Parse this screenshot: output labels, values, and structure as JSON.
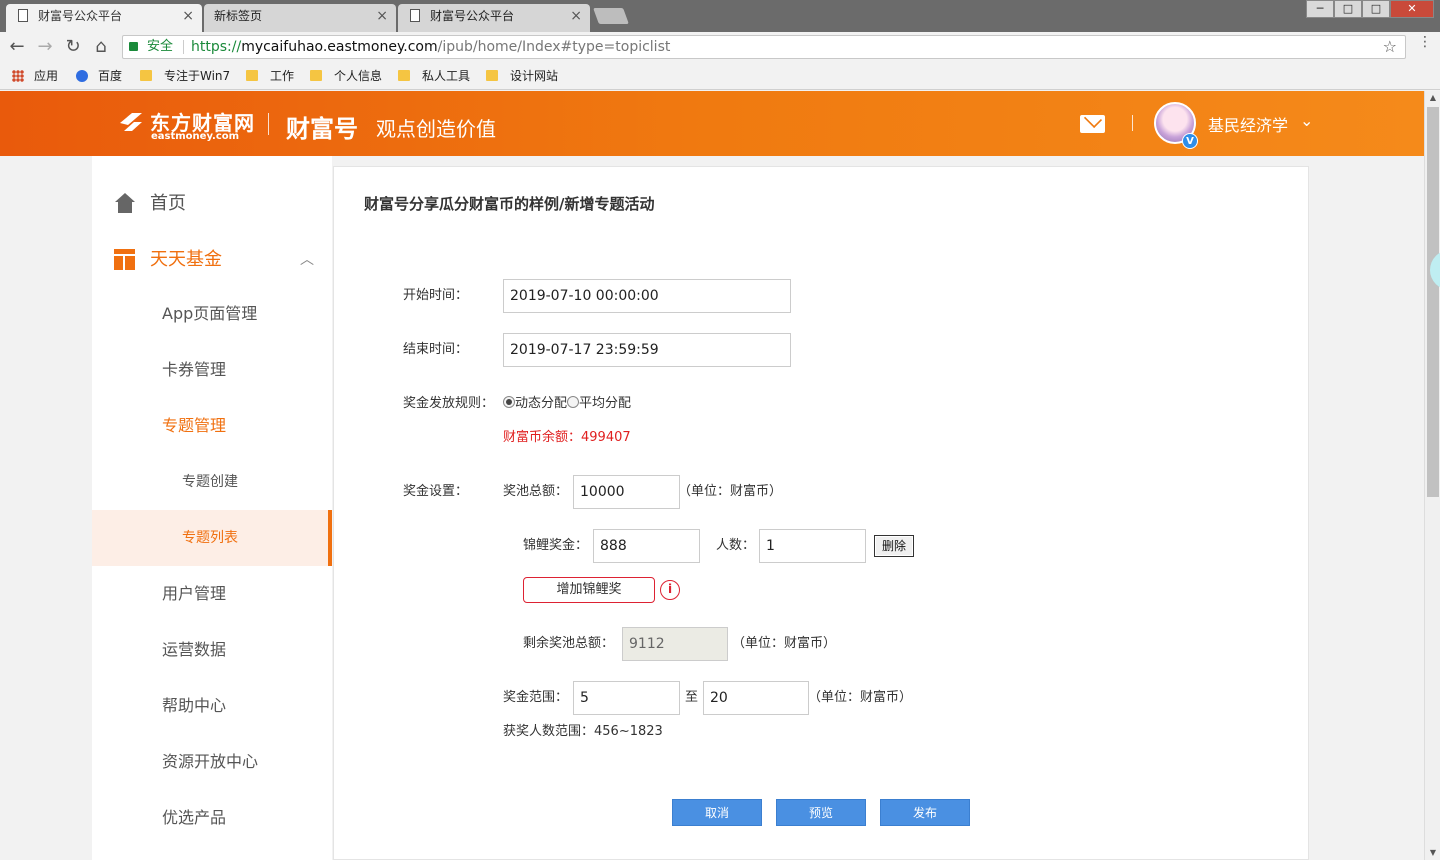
{
  "browser": {
    "tabs": [
      {
        "title": "财富号公众平台",
        "active": true
      },
      {
        "title": "新标签页",
        "active": false
      },
      {
        "title": "财富号公众平台",
        "active": false
      }
    ],
    "window_controls": {
      "minimize": "─",
      "maximize": "□",
      "close": "✕"
    },
    "secure_label": "安全",
    "url_scheme": "https://",
    "url_host": "mycaifuhao.eastmoney.com",
    "url_path": "/ipub/home/Index#type=topiclist",
    "bookmarks": [
      "应用",
      "百度",
      "专注于Win7",
      "工作",
      "个人信息",
      "私人工具",
      "设计网站"
    ]
  },
  "header": {
    "logo_cn": "东方财富网",
    "logo_en": "eastmoney.com",
    "brand": "财富号",
    "slogan": "观点创造价值",
    "user_name": "基民经济学",
    "badge": "V",
    "accent_color": "#f07010"
  },
  "sidebar": {
    "home": "首页",
    "fund": "天天基金",
    "items": [
      {
        "label": "App页面管理"
      },
      {
        "label": "卡券管理"
      },
      {
        "label": "专题管理"
      },
      {
        "label": "专题创建"
      },
      {
        "label": "专题列表"
      },
      {
        "label": "用户管理"
      },
      {
        "label": "运营数据"
      },
      {
        "label": "帮助中心"
      },
      {
        "label": "资源开放中心"
      },
      {
        "label": "优选产品"
      }
    ]
  },
  "form": {
    "title": "财富号分享瓜分财富币的样例/新增专题活动",
    "start_label": "开始时间：",
    "start_value": "2019-07-10 00:00:00",
    "end_label": "结束时间：",
    "end_value": "2019-07-17 23:59:59",
    "rule_label": "奖金发放规则：",
    "rule_options": [
      "动态分配",
      "平均分配"
    ],
    "rule_selected": "动态分配",
    "balance_text": "财富币余额：499407",
    "prize_label": "奖金设置：",
    "pool_label": "奖池总额：",
    "pool_value": "10000",
    "unit_text": "（单位：财富币）",
    "koi_label": "锦鲤奖金：",
    "koi_value": "888",
    "people_label": "人数：",
    "people_value": "1",
    "delete_label": "删除",
    "add_koi_label": "增加锦鲤奖",
    "info_glyph": "i",
    "remaining_label": "剩余奖池总额：",
    "remaining_value": "9112",
    "remaining_unit": "（单位：财富币）",
    "range_label": "奖金范围：",
    "range_min": "5",
    "range_to": "至",
    "range_max": "20",
    "range_unit": "（单位：财富币）",
    "winners_text": "获奖人数范围：456~1823",
    "buttons": {
      "cancel": "取消",
      "preview": "预览",
      "publish": "发布"
    }
  }
}
